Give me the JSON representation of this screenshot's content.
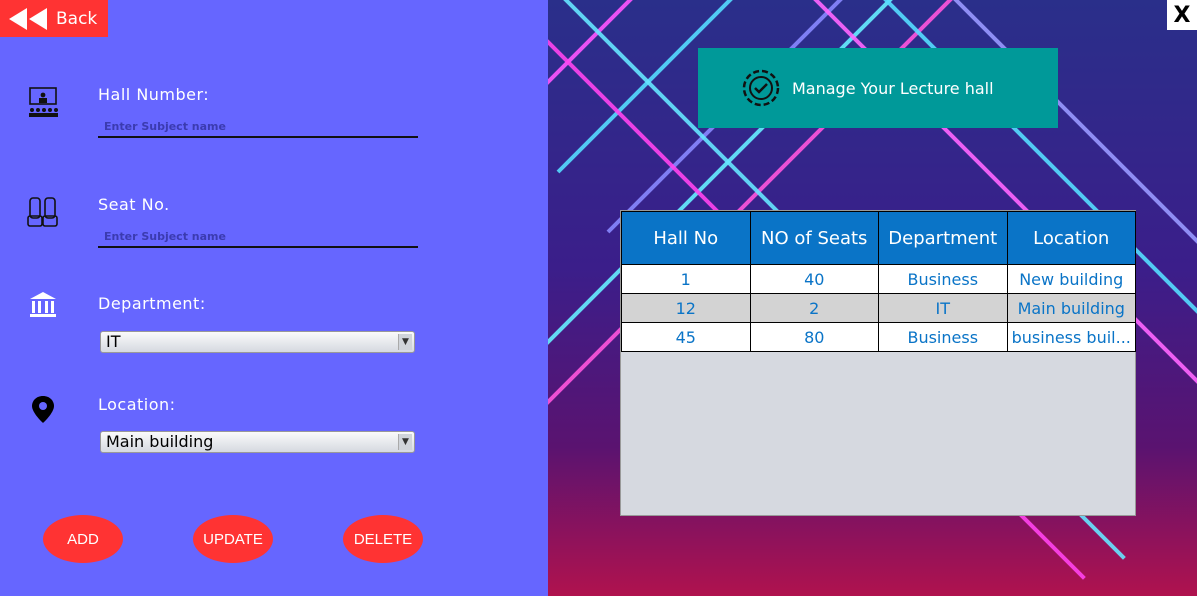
{
  "nav": {
    "back_label": "Back",
    "close_label": "X"
  },
  "form": {
    "hall_number": {
      "label": "Hall Number:",
      "placeholder": "Enter Subject name"
    },
    "seat_no": {
      "label": "Seat No.",
      "placeholder": "Enter Subject name"
    },
    "department": {
      "label": "Department:",
      "selected": "IT"
    },
    "location": {
      "label": "Location:",
      "selected": "Main building"
    }
  },
  "actions": {
    "add": "ADD",
    "update": "UPDATE",
    "delete": "DELETE"
  },
  "header": {
    "title": "Manage Your Lecture hall"
  },
  "table": {
    "columns": [
      "Hall No",
      "NO of Seats",
      "Department",
      "Location"
    ],
    "rows": [
      [
        "1",
        "40",
        "Business",
        "New building"
      ],
      [
        "12",
        "2",
        "IT",
        "Main building"
      ],
      [
        "45",
        "80",
        "Business",
        "business buil..."
      ]
    ]
  },
  "colors": {
    "left_panel": "#6666ff",
    "accent_red": "#ff3333",
    "header_teal": "#009999",
    "table_header": "#0a74c7"
  }
}
